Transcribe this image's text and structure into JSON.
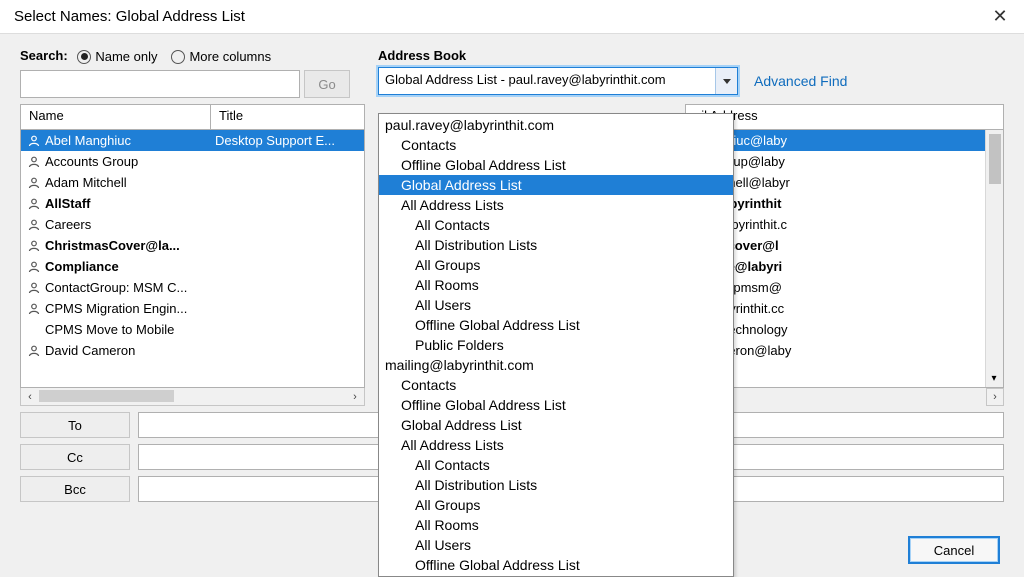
{
  "titlebar": {
    "title": "Select Names: Global Address List"
  },
  "search": {
    "label": "Search:",
    "name_only": "Name only",
    "more_columns": "More columns",
    "go": "Go"
  },
  "address_book": {
    "label": "Address Book",
    "selected": "Global Address List - paul.ravey@labyrinthit.com",
    "advanced_find": "Advanced Find"
  },
  "columns": {
    "name": "Name",
    "title": "Title",
    "email": "ail Address"
  },
  "entries": [
    {
      "name": "Abel Manghiuc",
      "title": "Desktop Support E...",
      "bold": false,
      "selected": true,
      "email": ".Manghiuc@laby"
    },
    {
      "name": "Accounts Group",
      "title": "",
      "bold": false,
      "selected": false,
      "email": "untsgroup@laby"
    },
    {
      "name": "Adam Mitchell",
      "title": "",
      "bold": false,
      "selected": false,
      "email": "m.Mitchell@labyr"
    },
    {
      "name": "AllStaff",
      "title": "",
      "bold": true,
      "selected": false,
      "email": "aff@labyrinthit"
    },
    {
      "name": "Careers",
      "title": "",
      "bold": false,
      "selected": false,
      "email": "ers@labyrinthit.c"
    },
    {
      "name": "ChristmasCover@la...",
      "title": "",
      "bold": true,
      "selected": false,
      "email": "stmascover@l"
    },
    {
      "name": "Compliance",
      "title": "",
      "bold": true,
      "selected": false,
      "email": "pliance@labyri"
    },
    {
      "name": "ContactGroup: MSM C...",
      "title": "",
      "bold": false,
      "selected": false,
      "email": "actgroupmsm@"
    },
    {
      "name": "CPMS Migration Engin...",
      "title": "",
      "bold": false,
      "selected": false,
      "email": "S@labyrinthit.cc"
    },
    {
      "name": "CPMS Move to Mobile",
      "title": "",
      "bold": false,
      "selected": false,
      "email": "yrinthTechnology",
      "noicon": true
    },
    {
      "name": "David Cameron",
      "title": "",
      "bold": false,
      "selected": false,
      "email": "d Cameron@laby"
    }
  ],
  "dropdown": [
    {
      "text": "paul.ravey@labyrinthit.com",
      "indent": 0,
      "selected": false
    },
    {
      "text": "Contacts",
      "indent": 1,
      "selected": false
    },
    {
      "text": "Offline Global Address List",
      "indent": 1,
      "selected": false
    },
    {
      "text": "Global Address List",
      "indent": 1,
      "selected": true
    },
    {
      "text": "All Address Lists",
      "indent": 1,
      "selected": false
    },
    {
      "text": "All Contacts",
      "indent": 2,
      "selected": false
    },
    {
      "text": "All Distribution Lists",
      "indent": 2,
      "selected": false
    },
    {
      "text": "All Groups",
      "indent": 2,
      "selected": false
    },
    {
      "text": "All Rooms",
      "indent": 2,
      "selected": false
    },
    {
      "text": "All Users",
      "indent": 2,
      "selected": false
    },
    {
      "text": "Offline Global Address List",
      "indent": 2,
      "selected": false
    },
    {
      "text": "Public Folders",
      "indent": 2,
      "selected": false
    },
    {
      "text": "mailing@labyrinthit.com",
      "indent": 0,
      "selected": false
    },
    {
      "text": "Contacts",
      "indent": 1,
      "selected": false
    },
    {
      "text": "Offline Global Address List",
      "indent": 1,
      "selected": false
    },
    {
      "text": "Global Address List",
      "indent": 1,
      "selected": false
    },
    {
      "text": "All Address Lists",
      "indent": 1,
      "selected": false
    },
    {
      "text": "All Contacts",
      "indent": 2,
      "selected": false
    },
    {
      "text": "All Distribution Lists",
      "indent": 2,
      "selected": false
    },
    {
      "text": "All Groups",
      "indent": 2,
      "selected": false
    },
    {
      "text": "All Rooms",
      "indent": 2,
      "selected": false
    },
    {
      "text": "All Users",
      "indent": 2,
      "selected": false
    },
    {
      "text": "Offline Global Address List",
      "indent": 2,
      "selected": false
    }
  ],
  "recipients": {
    "to": "To",
    "cc": "Cc",
    "bcc": "Bcc"
  },
  "buttons": {
    "cancel": "Cancel"
  }
}
